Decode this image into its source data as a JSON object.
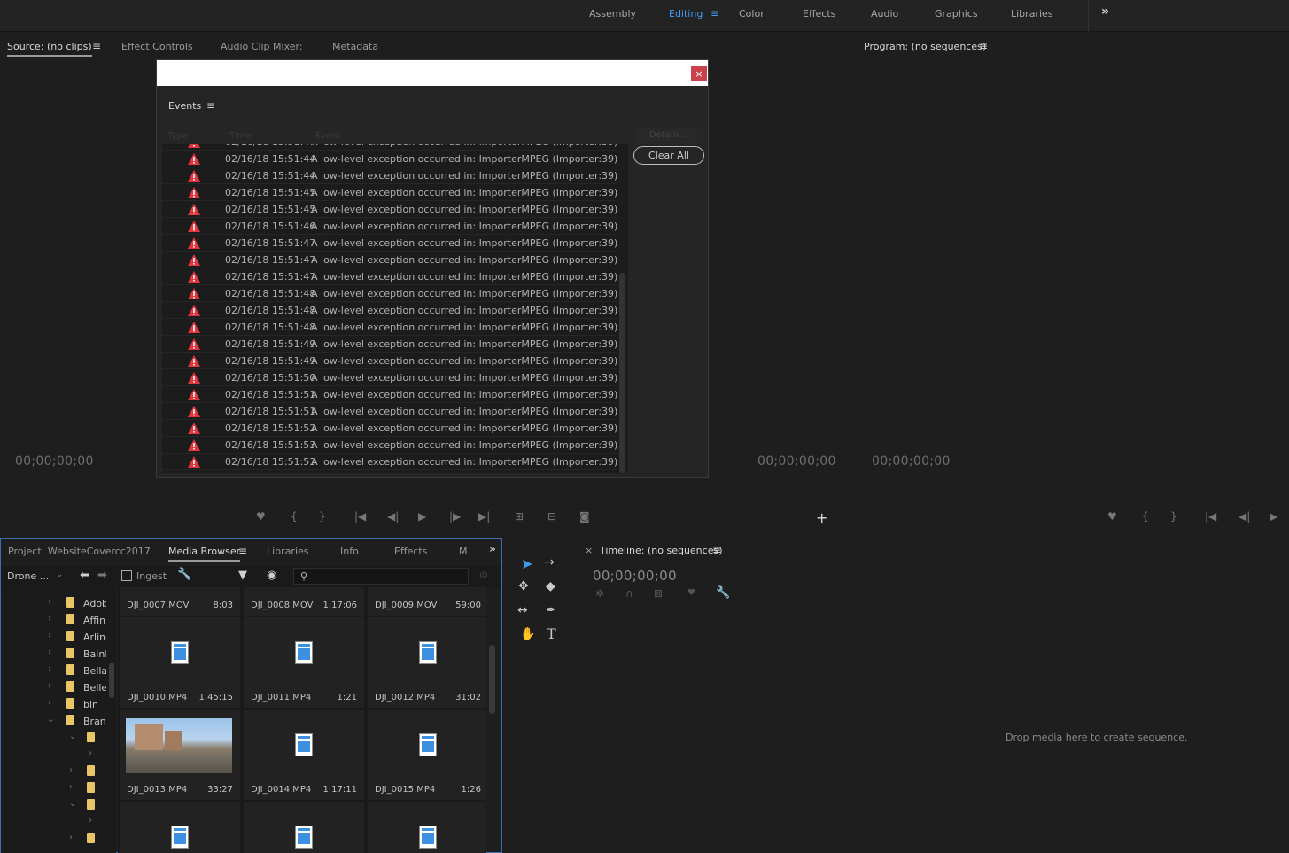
{
  "workspaces": {
    "tabs": [
      {
        "label": "Assembly"
      },
      {
        "label": "Editing"
      },
      {
        "label": "Color"
      },
      {
        "label": "Effects"
      },
      {
        "label": "Audio"
      },
      {
        "label": "Graphics"
      },
      {
        "label": "Libraries"
      }
    ],
    "active": "Editing"
  },
  "source_panel": {
    "tabs": [
      "Source: (no clips)",
      "Effect Controls",
      "Audio Clip Mixer:",
      "Metadata"
    ],
    "timecode_left": "00;00;00;00",
    "timecode_right": "00;00;00;00"
  },
  "program_panel": {
    "title": "Program: (no sequences)",
    "timecode": "00;00;00;00"
  },
  "events_dialog": {
    "panel_label": "Events",
    "columns": [
      "Type",
      "Time",
      "Event"
    ],
    "details_button": "Details...",
    "clear_button": "Clear All",
    "top_partial_row": {
      "time": "02/16/18 15:51:44",
      "message": "A low-level exception occurred in: ImporterMPEG (Importer:39)"
    },
    "rows": [
      {
        "time": "02/16/18 15:51:44",
        "message": "A low-level exception occurred in: ImporterMPEG (Importer:39)"
      },
      {
        "time": "02/16/18 15:51:44",
        "message": "A low-level exception occurred in: ImporterMPEG (Importer:39)"
      },
      {
        "time": "02/16/18 15:51:45",
        "message": "A low-level exception occurred in: ImporterMPEG (Importer:39)"
      },
      {
        "time": "02/16/18 15:51:45",
        "message": "A low-level exception occurred in: ImporterMPEG (Importer:39)"
      },
      {
        "time": "02/16/18 15:51:46",
        "message": "A low-level exception occurred in: ImporterMPEG (Importer:39)"
      },
      {
        "time": "02/16/18 15:51:47",
        "message": "A low-level exception occurred in: ImporterMPEG (Importer:39)"
      },
      {
        "time": "02/16/18 15:51:47",
        "message": "A low-level exception occurred in: ImporterMPEG (Importer:39)"
      },
      {
        "time": "02/16/18 15:51:47",
        "message": "A low-level exception occurred in: ImporterMPEG (Importer:39)"
      },
      {
        "time": "02/16/18 15:51:48",
        "message": "A low-level exception occurred in: ImporterMPEG (Importer:39)"
      },
      {
        "time": "02/16/18 15:51:48",
        "message": "A low-level exception occurred in: ImporterMPEG (Importer:39)"
      },
      {
        "time": "02/16/18 15:51:48",
        "message": "A low-level exception occurred in: ImporterMPEG (Importer:39)"
      },
      {
        "time": "02/16/18 15:51:49",
        "message": "A low-level exception occurred in: ImporterMPEG (Importer:39)"
      },
      {
        "time": "02/16/18 15:51:49",
        "message": "A low-level exception occurred in: ImporterMPEG (Importer:39)"
      },
      {
        "time": "02/16/18 15:51:50",
        "message": "A low-level exception occurred in: ImporterMPEG (Importer:39)"
      },
      {
        "time": "02/16/18 15:51:51",
        "message": "A low-level exception occurred in: ImporterMPEG (Importer:39)"
      },
      {
        "time": "02/16/18 15:51:51",
        "message": "A low-level exception occurred in: ImporterMPEG (Importer:39)"
      },
      {
        "time": "02/16/18 15:51:52",
        "message": "A low-level exception occurred in: ImporterMPEG (Importer:39)"
      },
      {
        "time": "02/16/18 15:51:53",
        "message": "A low-level exception occurred in: ImporterMPEG (Importer:39)"
      },
      {
        "time": "02/16/18 15:51:53",
        "message": "A low-level exception occurred in: ImporterMPEG (Importer:39)"
      }
    ]
  },
  "project_panel": {
    "tabs": [
      "Project: WebsiteCovercc2017",
      "Media Browser",
      "Libraries",
      "Info",
      "Effects",
      "M"
    ],
    "location": "Drone ...",
    "ingest_label": "Ingest",
    "tree": [
      {
        "label": "Adob"
      },
      {
        "label": "Affini"
      },
      {
        "label": "Arling"
      },
      {
        "label": "BainB"
      },
      {
        "label": "Bella"
      },
      {
        "label": "Bellev"
      },
      {
        "label": "bin"
      },
      {
        "label": "Brang"
      }
    ],
    "tiles": [
      {
        "name": "DJI_0007.MOV",
        "duration": "8:03"
      },
      {
        "name": "DJI_0008.MOV",
        "duration": "1:17:06"
      },
      {
        "name": "DJI_0009.MOV",
        "duration": "59:00"
      },
      {
        "name": "DJI_0010.MP4",
        "duration": "1:45:15"
      },
      {
        "name": "DJI_0011.MP4",
        "duration": "1:21"
      },
      {
        "name": "DJI_0012.MP4",
        "duration": "31:02"
      },
      {
        "name": "DJI_0013.MP4",
        "duration": "33:27"
      },
      {
        "name": "DJI_0014.MP4",
        "duration": "1:17:11"
      },
      {
        "name": "DJI_0015.MP4",
        "duration": "1:26"
      }
    ]
  },
  "timeline_panel": {
    "title": "Timeline: (no sequences)",
    "timecode": "00;00;00;00",
    "drop_hint": "Drop media here to create sequence."
  },
  "colors": {
    "accent": "#3f9cf0",
    "warning": "#e0363f",
    "background": "#1d1d1d"
  }
}
